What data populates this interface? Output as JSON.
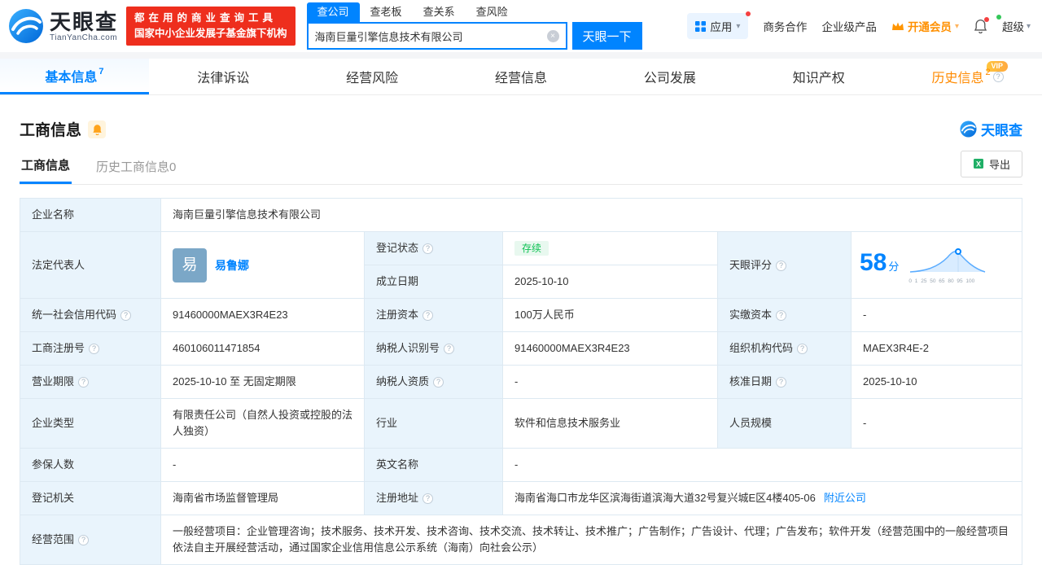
{
  "icons": {
    "caret_down": "▾",
    "clear": "×",
    "info": "?"
  },
  "header": {
    "brand": "天眼查",
    "brand_domain": "TianYanCha.com",
    "slogan_line1": "都在用的商业查询工具",
    "slogan_line2": "国家中小企业发展子基金旗下机构",
    "search": {
      "tabs": [
        {
          "label": "查公司",
          "active": true
        },
        {
          "label": "查老板",
          "active": false
        },
        {
          "label": "查关系",
          "active": false
        },
        {
          "label": "查风险",
          "active": false
        }
      ],
      "value": "海南巨量引擎信息技术有限公司",
      "button": "天眼一下"
    },
    "nav": {
      "apps": "应用",
      "business": "商务合作",
      "enterprise": "企业级产品",
      "vip": "开通会员",
      "super": "超级"
    }
  },
  "tabs": [
    {
      "label": "基本信息",
      "badge": "7"
    },
    {
      "label": "法律诉讼"
    },
    {
      "label": "经营风险"
    },
    {
      "label": "经营信息"
    },
    {
      "label": "公司发展"
    },
    {
      "label": "知识产权"
    },
    {
      "label": "历史信息",
      "badge": "2",
      "vip_tag": "VIP"
    }
  ],
  "section": {
    "title": "工商信息",
    "watermark": "天眼查",
    "subtabs": [
      {
        "label": "工商信息",
        "active": true
      },
      {
        "label": "历史工商信息0",
        "active": false
      }
    ],
    "export_label": "导出"
  },
  "table": {
    "company_name": {
      "label": "企业名称",
      "value": "海南巨量引擎信息技术有限公司"
    },
    "legal_rep": {
      "label": "法定代表人",
      "avatar": "易",
      "name": "易鲁娜"
    },
    "reg_status": {
      "label": "登记状态",
      "value": "存续"
    },
    "establish_date": {
      "label": "成立日期",
      "value": "2025-10-10"
    },
    "score": {
      "label": "天眼评分",
      "value": "58",
      "unit": "分",
      "ticks": "0 1 25 50 65 80 95 100"
    },
    "credit_code": {
      "label": "统一社会信用代码",
      "value": "91460000MAEX3R4E23"
    },
    "reg_capital": {
      "label": "注册资本",
      "value": "100万人民币"
    },
    "paid_capital": {
      "label": "实缴资本",
      "value": "-"
    },
    "reg_number": {
      "label": "工商注册号",
      "value": "460106011471854"
    },
    "taxpayer_id": {
      "label": "纳税人识别号",
      "value": "91460000MAEX3R4E23"
    },
    "org_code": {
      "label": "组织机构代码",
      "value": "MAEX3R4E-2"
    },
    "business_term": {
      "label": "营业期限",
      "value": "2025-10-10 至 无固定期限"
    },
    "taxpayer_qual": {
      "label": "纳税人资质",
      "value": "-"
    },
    "approval_date": {
      "label": "核准日期",
      "value": "2025-10-10"
    },
    "company_type": {
      "label": "企业类型",
      "value": "有限责任公司（自然人投资或控股的法人独资）"
    },
    "industry": {
      "label": "行业",
      "value": "软件和信息技术服务业"
    },
    "staff_size": {
      "label": "人员规模",
      "value": "-"
    },
    "insured_count": {
      "label": "参保人数",
      "value": "-"
    },
    "english_name": {
      "label": "英文名称",
      "value": "-"
    },
    "reg_authority": {
      "label": "登记机关",
      "value": "海南省市场监督管理局"
    },
    "reg_address": {
      "label": "注册地址",
      "value": "海南省海口市龙华区滨海街道滨海大道32号复兴城E区4楼405-06",
      "link": "附近公司"
    },
    "business_scope": {
      "label": "经营范围",
      "value": "一般经营项目：企业管理咨询；技术服务、技术开发、技术咨询、技术交流、技术转让、技术推广；广告制作；广告设计、代理；广告发布；软件开发（经营范围中的一般经营项目依法自主开展经营活动，通过国家企业信用信息公示系统（海南）向社会公示）"
    }
  }
}
